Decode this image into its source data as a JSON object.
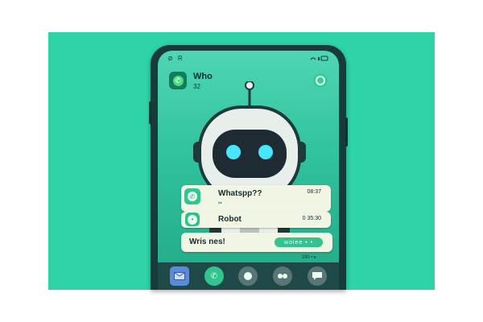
{
  "status_bar": {
    "left": "R",
    "right": ""
  },
  "header": {
    "title": "Who",
    "subtitle": "32"
  },
  "messages": [
    {
      "text": "Whatspp??",
      "time": "08:37",
      "note": "✂"
    },
    {
      "text": "Robot",
      "time": "0 35:30"
    }
  ],
  "compose": {
    "text": "Wris nes!",
    "pill": "woiee • •"
  },
  "meta_text": "190 • ▸",
  "colors": {
    "background": "#2ed3a6",
    "phone": "#183a3a",
    "accent": "#31c48f"
  }
}
